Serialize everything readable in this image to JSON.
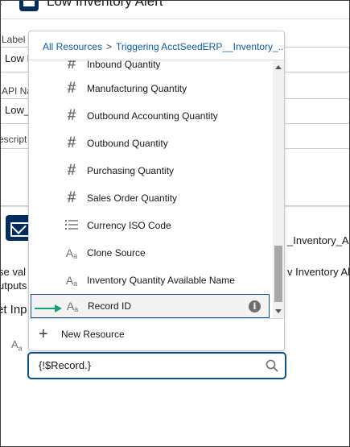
{
  "page": {
    "title": "Low Inventory Alert",
    "label_field_label": "Label",
    "label_field_value": "Low I",
    "api_field_label": "API Na",
    "api_field_value": "Low_",
    "description_label": "escript",
    "action_name_fragment": "_Inventory_Ale",
    "help_text_fragment": "se val",
    "help_text_fragment2": "utputs",
    "action_label_fragment": "v Inventory Ale",
    "section_heading": "et Inp"
  },
  "dropdown": {
    "breadcrumb_root": "All Resources",
    "breadcrumb_separator": ">",
    "breadcrumb_current": "Triggering AcctSeedERP__Inventory_...",
    "items": [
      {
        "label": "Inbound Quantity",
        "icon": "number-icon"
      },
      {
        "label": "Manufacturing Quantity",
        "icon": "number-icon"
      },
      {
        "label": "Outbound Accounting Quantity",
        "icon": "number-icon"
      },
      {
        "label": "Outbound Quantity",
        "icon": "number-icon"
      },
      {
        "label": "Purchasing Quantity",
        "icon": "number-icon"
      },
      {
        "label": "Sales Order Quantity",
        "icon": "number-icon"
      },
      {
        "label": "Currency ISO Code",
        "icon": "picklist-icon"
      },
      {
        "label": "Clone Source",
        "icon": "text-icon"
      },
      {
        "label": "Inventory Quantity Available Name",
        "icon": "text-icon"
      },
      {
        "label": "Record ID",
        "icon": "text-icon",
        "selected": true
      }
    ],
    "new_resource_label": "New Resource"
  },
  "value_input": {
    "value": "{!$Record.}"
  },
  "colors": {
    "accent": "#0b5394",
    "link": "#0b5cab",
    "annotation_arrow": "#1a9e7a",
    "icon_bg": "#032d60"
  }
}
